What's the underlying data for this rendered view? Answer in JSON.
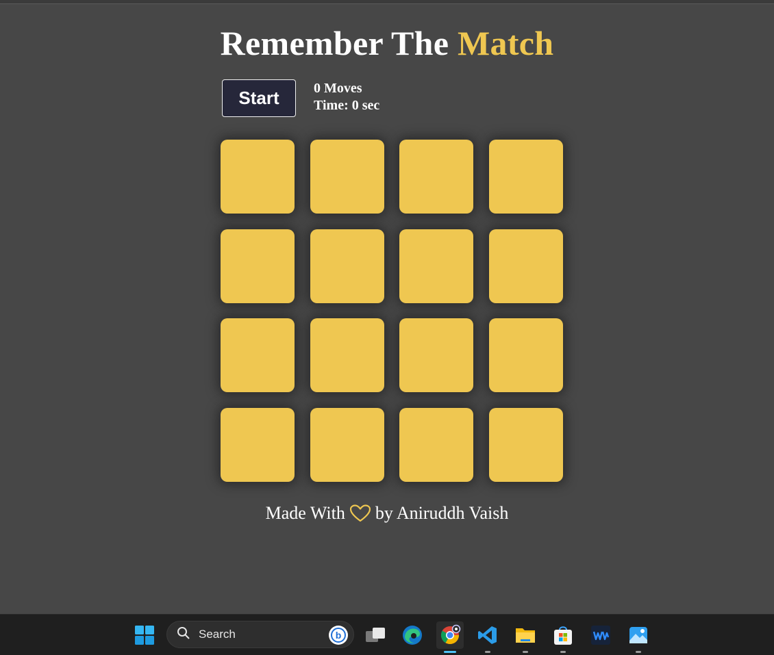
{
  "title": {
    "prefix": "Remember The",
    "accent": "Match"
  },
  "controls": {
    "start_label": "Start",
    "moves_text": "0 Moves",
    "time_text": "Time: 0 sec"
  },
  "board": {
    "rows": 4,
    "cols": 4,
    "card_color": "#efc751"
  },
  "footer": {
    "before": "Made With",
    "after": "by Aniruddh Vaish",
    "heart_icon": "heart-outline-icon"
  },
  "taskbar": {
    "search_placeholder": "Search",
    "icons": [
      "windows-start-icon",
      "search-icon",
      "bing-icon",
      "task-view-icon",
      "edge-icon",
      "chrome-icon",
      "vscode-icon",
      "file-explorer-icon",
      "microsoft-store-icon",
      "waves-app-icon",
      "photos-icon"
    ]
  },
  "colors": {
    "background": "#474747",
    "accent": "#efc751",
    "button_bg": "#26273a",
    "taskbar": "#1f1f1f"
  }
}
